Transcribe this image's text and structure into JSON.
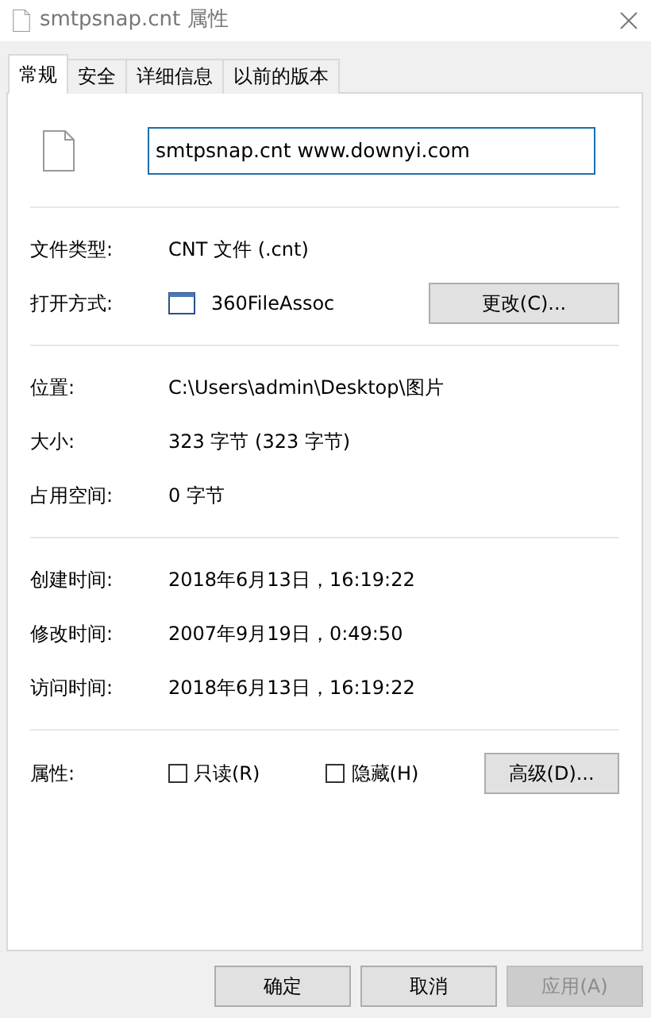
{
  "window": {
    "title": "smtpsnap.cnt 属性"
  },
  "tabs": [
    {
      "label": "常规",
      "selected": true
    },
    {
      "label": "安全",
      "selected": false
    },
    {
      "label": "详细信息",
      "selected": false
    },
    {
      "label": "以前的版本",
      "selected": false
    }
  ],
  "file_name": {
    "value": "smtpsnap.cnt www.downyi.com"
  },
  "sections": [
    {
      "rows": [
        {
          "kind": "text",
          "label": "文件类型:",
          "value": "CNT 文件 (.cnt)"
        },
        {
          "kind": "app",
          "label": "打开方式:",
          "value": "360FileAssoc",
          "button": "更改(C)..."
        }
      ]
    },
    {
      "rows": [
        {
          "kind": "text",
          "label": "位置:",
          "value": "C:\\Users\\admin\\Desktop\\图片"
        },
        {
          "kind": "text",
          "label": "大小:",
          "value": "323 字节 (323 字节)"
        },
        {
          "kind": "text",
          "label": "占用空间:",
          "value": "0 字节"
        }
      ]
    },
    {
      "rows": [
        {
          "kind": "text",
          "label": "创建时间:",
          "value": "2018年6月13日，16:19:22"
        },
        {
          "kind": "text",
          "label": "修改时间:",
          "value": "2007年9月19日，0:49:50"
        },
        {
          "kind": "text",
          "label": "访问时间:",
          "value": "2018年6月13日，16:19:22"
        }
      ]
    }
  ],
  "attributes": {
    "label": "属性:",
    "checkboxes": [
      {
        "label": "只读(R)",
        "checked": false
      },
      {
        "label": "隐藏(H)",
        "checked": false
      }
    ],
    "button": "高级(D)..."
  },
  "footer_buttons": [
    {
      "label": "确定",
      "disabled": false
    },
    {
      "label": "取消",
      "disabled": false
    },
    {
      "label": "应用(A)",
      "disabled": true
    }
  ]
}
